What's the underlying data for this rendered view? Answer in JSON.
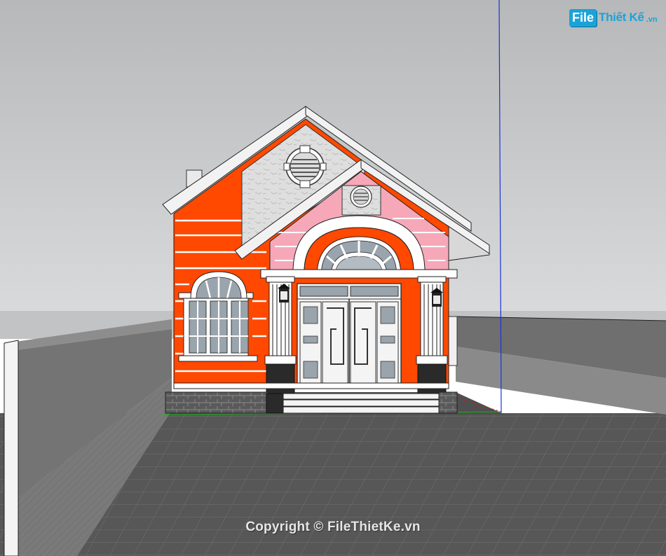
{
  "logo": {
    "badge": "File",
    "text": "Thiết Kế",
    "ext": ".vn"
  },
  "watermark": "Copyright © FileThietKe.vn",
  "colors": {
    "sky_top": "#b6b8ba",
    "sky_bottom": "#d8d9da",
    "ground": "#555555",
    "tile_line": "#6b6b6b",
    "wall_orange": "#ff4800",
    "wall_pink": "#f6a8b8",
    "stone": "#dcdcdc",
    "trim": "#ffffff",
    "fence": "#6e6e6e",
    "axis_blue": "#1c33d6",
    "axis_green": "#12b312",
    "axis_red": "#d01a1a",
    "logo_blue": "#1aa3d9"
  },
  "icons": [
    "vent-icon",
    "lamp-icon",
    "arch-window-icon",
    "door-icon"
  ]
}
